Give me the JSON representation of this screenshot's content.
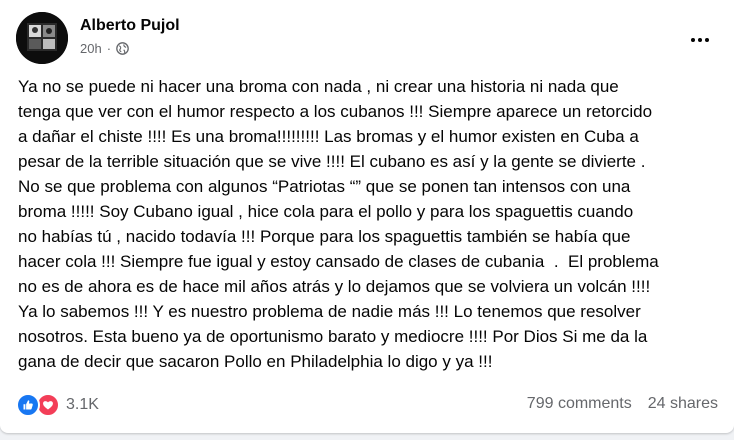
{
  "post": {
    "author": "Alberto Pujol",
    "time": "20h",
    "separator": "·",
    "audience_icon": "globe-icon",
    "more_icon": "more-options-icon",
    "lines": [
      "Ya no se puede ni hacer una broma con nada , ni crear una historia ni nada que",
      "tenga que ver con el humor respecto a los cubanos !!! Siempre aparece un retorcido",
      "a dañar el chiste !!!! Es una broma!!!!!!!!! Las bromas y el humor existen en Cuba a",
      "pesar de la terrible situación que se vive !!!! El cubano es así y la gente se divierte .",
      "No se que problema con algunos “Patriotas “” que se ponen tan intensos con una",
      "broma !!!!! Soy Cubano igual , hice cola para el pollo y para los spaguettis cuando",
      "no habías tú , nacido todavía !!! Porque para los spaguettis también se había que",
      "hacer cola !!! Siempre fue igual y estoy cansado de clases de cubania  .  El problema",
      "no es de ahora es de hace mil años atrás y lo dejamos que se volviera un volcán !!!!",
      "Ya lo sabemos !!! Y es nuestro problema de nadie más !!! Lo tenemos que resolver",
      "nosotros. Esta bueno ya de oportunismo barato y mediocre !!!! Por Dios Si me da la",
      "gana de decir que sacaron Pollo en Philadelphia lo digo y ya !!!"
    ]
  },
  "footer": {
    "reactions": [
      "like-reaction-icon",
      "love-reaction-icon"
    ],
    "reaction_count": "3.1K",
    "comments": "799 comments",
    "shares": "24 shares"
  },
  "colors": {
    "text": "#050505",
    "secondary": "#65676b",
    "like": "#1877f2",
    "love": "#f33e58",
    "background": "#f0f2f5"
  }
}
